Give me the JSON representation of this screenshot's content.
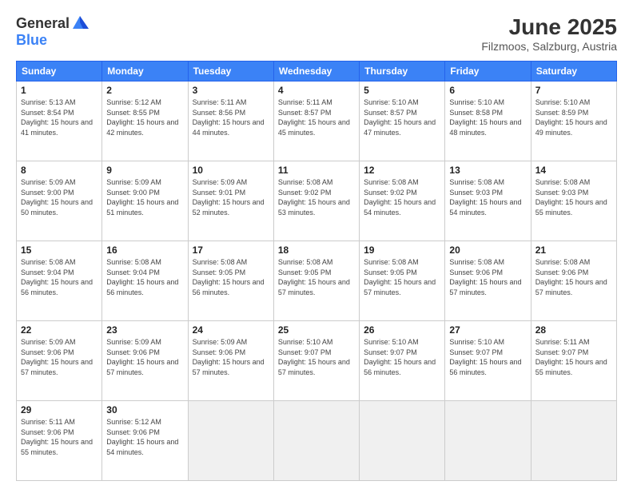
{
  "header": {
    "logo_general": "General",
    "logo_blue": "Blue",
    "title": "June 2025",
    "subtitle": "Filzmoos, Salzburg, Austria"
  },
  "days_of_week": [
    "Sunday",
    "Monday",
    "Tuesday",
    "Wednesday",
    "Thursday",
    "Friday",
    "Saturday"
  ],
  "cells": [
    {
      "day": "",
      "empty": true
    },
    {
      "day": "",
      "empty": true
    },
    {
      "day": "",
      "empty": true
    },
    {
      "day": "",
      "empty": true
    },
    {
      "day": "",
      "empty": true
    },
    {
      "day": "",
      "empty": true
    },
    {
      "day": "7",
      "info": "Sunrise: 5:10 AM\nSunset: 8:59 PM\nDaylight: 15 hours\nand 49 minutes."
    },
    {
      "day": "1",
      "info": "Sunrise: 5:13 AM\nSunset: 8:54 PM\nDaylight: 15 hours\nand 41 minutes."
    },
    {
      "day": "2",
      "info": "Sunrise: 5:12 AM\nSunset: 8:55 PM\nDaylight: 15 hours\nand 42 minutes."
    },
    {
      "day": "3",
      "info": "Sunrise: 5:11 AM\nSunset: 8:56 PM\nDaylight: 15 hours\nand 44 minutes."
    },
    {
      "day": "4",
      "info": "Sunrise: 5:11 AM\nSunset: 8:57 PM\nDaylight: 15 hours\nand 45 minutes."
    },
    {
      "day": "5",
      "info": "Sunrise: 5:10 AM\nSunset: 8:57 PM\nDaylight: 15 hours\nand 47 minutes."
    },
    {
      "day": "6",
      "info": "Sunrise: 5:10 AM\nSunset: 8:58 PM\nDaylight: 15 hours\nand 48 minutes."
    },
    {
      "day": "7",
      "info": "Sunrise: 5:10 AM\nSunset: 8:59 PM\nDaylight: 15 hours\nand 49 minutes."
    },
    {
      "day": "8",
      "info": "Sunrise: 5:09 AM\nSunset: 9:00 PM\nDaylight: 15 hours\nand 50 minutes."
    },
    {
      "day": "9",
      "info": "Sunrise: 5:09 AM\nSunset: 9:00 PM\nDaylight: 15 hours\nand 51 minutes."
    },
    {
      "day": "10",
      "info": "Sunrise: 5:09 AM\nSunset: 9:01 PM\nDaylight: 15 hours\nand 52 minutes."
    },
    {
      "day": "11",
      "info": "Sunrise: 5:08 AM\nSunset: 9:02 PM\nDaylight: 15 hours\nand 53 minutes."
    },
    {
      "day": "12",
      "info": "Sunrise: 5:08 AM\nSunset: 9:02 PM\nDaylight: 15 hours\nand 54 minutes."
    },
    {
      "day": "13",
      "info": "Sunrise: 5:08 AM\nSunset: 9:03 PM\nDaylight: 15 hours\nand 54 minutes."
    },
    {
      "day": "14",
      "info": "Sunrise: 5:08 AM\nSunset: 9:03 PM\nDaylight: 15 hours\nand 55 minutes."
    },
    {
      "day": "15",
      "info": "Sunrise: 5:08 AM\nSunset: 9:04 PM\nDaylight: 15 hours\nand 56 minutes."
    },
    {
      "day": "16",
      "info": "Sunrise: 5:08 AM\nSunset: 9:04 PM\nDaylight: 15 hours\nand 56 minutes."
    },
    {
      "day": "17",
      "info": "Sunrise: 5:08 AM\nSunset: 9:05 PM\nDaylight: 15 hours\nand 56 minutes."
    },
    {
      "day": "18",
      "info": "Sunrise: 5:08 AM\nSunset: 9:05 PM\nDaylight: 15 hours\nand 57 minutes."
    },
    {
      "day": "19",
      "info": "Sunrise: 5:08 AM\nSunset: 9:05 PM\nDaylight: 15 hours\nand 57 minutes."
    },
    {
      "day": "20",
      "info": "Sunrise: 5:08 AM\nSunset: 9:06 PM\nDaylight: 15 hours\nand 57 minutes."
    },
    {
      "day": "21",
      "info": "Sunrise: 5:08 AM\nSunset: 9:06 PM\nDaylight: 15 hours\nand 57 minutes."
    },
    {
      "day": "22",
      "info": "Sunrise: 5:09 AM\nSunset: 9:06 PM\nDaylight: 15 hours\nand 57 minutes."
    },
    {
      "day": "23",
      "info": "Sunrise: 5:09 AM\nSunset: 9:06 PM\nDaylight: 15 hours\nand 57 minutes."
    },
    {
      "day": "24",
      "info": "Sunrise: 5:09 AM\nSunset: 9:06 PM\nDaylight: 15 hours\nand 57 minutes."
    },
    {
      "day": "25",
      "info": "Sunrise: 5:10 AM\nSunset: 9:07 PM\nDaylight: 15 hours\nand 57 minutes."
    },
    {
      "day": "26",
      "info": "Sunrise: 5:10 AM\nSunset: 9:07 PM\nDaylight: 15 hours\nand 56 minutes."
    },
    {
      "day": "27",
      "info": "Sunrise: 5:10 AM\nSunset: 9:07 PM\nDaylight: 15 hours\nand 56 minutes."
    },
    {
      "day": "28",
      "info": "Sunrise: 5:11 AM\nSunset: 9:07 PM\nDaylight: 15 hours\nand 55 minutes."
    },
    {
      "day": "29",
      "info": "Sunrise: 5:11 AM\nSunset: 9:06 PM\nDaylight: 15 hours\nand 55 minutes."
    },
    {
      "day": "30",
      "info": "Sunrise: 5:12 AM\nSunset: 9:06 PM\nDaylight: 15 hours\nand 54 minutes."
    },
    {
      "day": "",
      "empty": true
    },
    {
      "day": "",
      "empty": true
    },
    {
      "day": "",
      "empty": true
    },
    {
      "day": "",
      "empty": true
    },
    {
      "day": "",
      "empty": true
    }
  ]
}
